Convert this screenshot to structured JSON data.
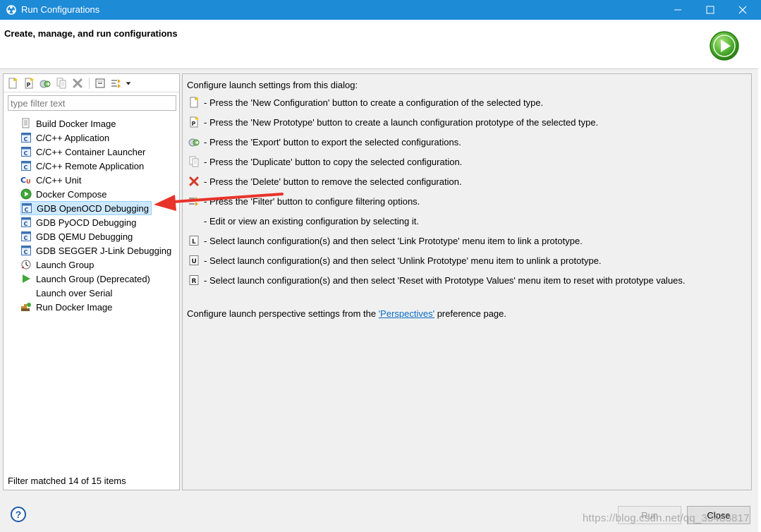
{
  "window": {
    "title": "Run Configurations",
    "titlebar_color": "#1e8bd6",
    "controls": [
      "minimize-icon",
      "maximize-icon",
      "close-icon"
    ]
  },
  "banner": {
    "heading": "Create, manage, and run configurations",
    "logo_icon": "run-icon"
  },
  "toolbar": {
    "buttons": [
      "new-configuration-icon",
      "new-prototype-icon",
      "export-icon",
      "duplicate-icon",
      "delete-icon",
      "collapse-all-icon",
      "filter-icon",
      "dropdown-icon"
    ]
  },
  "filter": {
    "placeholder": "type filter text"
  },
  "tree": {
    "items": [
      {
        "label": "Build Docker Image",
        "icon": "docker-build-icon"
      },
      {
        "label": "C/C++ Application",
        "icon": "c-app-icon"
      },
      {
        "label": "C/C++ Container Launcher",
        "icon": "c-app-icon"
      },
      {
        "label": "C/C++ Remote Application",
        "icon": "c-app-icon"
      },
      {
        "label": "C/C++ Unit",
        "icon": "c-unit-icon"
      },
      {
        "label": "Docker Compose",
        "icon": "docker-compose-icon"
      },
      {
        "label": "GDB OpenOCD Debugging",
        "icon": "c-app-icon",
        "selected": true
      },
      {
        "label": "GDB PyOCD Debugging",
        "icon": "c-app-icon"
      },
      {
        "label": "GDB QEMU Debugging",
        "icon": "c-app-icon"
      },
      {
        "label": "GDB SEGGER J-Link Debugging",
        "icon": "c-app-icon"
      },
      {
        "label": "Launch Group",
        "icon": "launch-group-icon"
      },
      {
        "label": "Launch Group (Deprecated)",
        "icon": "launch-group-deprecated-icon"
      },
      {
        "label": "Launch over Serial",
        "icon": ""
      },
      {
        "label": "Run Docker Image",
        "icon": "docker-run-icon"
      }
    ],
    "status": "Filter matched 14 of 15 items"
  },
  "right": {
    "intro": "Configure launch settings from this dialog:",
    "rows": [
      {
        "icon": "new-configuration-icon",
        "text": "- Press the 'New Configuration' button to create a configuration of the selected type."
      },
      {
        "icon": "new-prototype-icon",
        "text": "- Press the 'New Prototype' button to create a launch configuration prototype of the selected type."
      },
      {
        "icon": "export-icon",
        "text": "- Press the 'Export' button to export the selected configurations."
      },
      {
        "icon": "duplicate-icon",
        "text": "- Press the 'Duplicate' button to copy the selected configuration."
      },
      {
        "icon": "delete-icon",
        "text": "- Press the 'Delete' button to remove the selected configuration."
      },
      {
        "icon": "filter-icon",
        "text": "- Press the 'Filter' button to configure filtering options."
      },
      {
        "icon": "",
        "text": "- Edit or view an existing configuration by selecting it."
      },
      {
        "icon": "link-prototype-icon",
        "text": "- Select launch configuration(s) and then select 'Link Prototype' menu item to link a prototype."
      },
      {
        "icon": "unlink-prototype-icon",
        "text": "- Select launch configuration(s) and then select 'Unlink Prototype' menu item to unlink a prototype."
      },
      {
        "icon": "reset-prototype-icon",
        "text": "- Select launch configuration(s) and then select 'Reset with Prototype Values' menu item to reset with prototype values."
      }
    ],
    "perspectives_prefix": "Configure launch perspective settings from the ",
    "perspectives_link": "'Perspectives'",
    "perspectives_suffix": " preference page."
  },
  "footer": {
    "help_label": "?",
    "run_label": "Run",
    "close_label": "Close",
    "watermark": "https://blog.csdn.net/qq_33483817"
  },
  "colors": {
    "selection_bg": "#cce8ff",
    "arrow": "#e8332a",
    "link": "#0a6cc4"
  }
}
